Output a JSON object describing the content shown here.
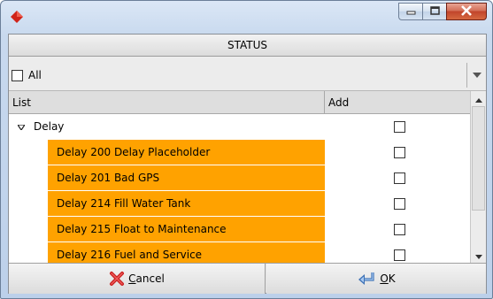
{
  "window": {
    "app_icon": "red-diamond-app-icon",
    "controls": [
      "minimize-icon",
      "maximize-icon",
      "close-icon"
    ]
  },
  "status_header": "STATUS",
  "filter": {
    "all_label": "All",
    "all_checked": false
  },
  "table": {
    "columns": [
      "List",
      "Add"
    ],
    "group": {
      "label": "Delay",
      "expanded": true
    },
    "rows": [
      {
        "label": "Delay 200 Delay Placeholder",
        "checked": false
      },
      {
        "label": "Delay 201 Bad GPS",
        "checked": false
      },
      {
        "label": "Delay 214 Fill Water Tank",
        "checked": false
      },
      {
        "label": "Delay 215 Float to Maintenance",
        "checked": false
      },
      {
        "label": "Delay 216 Fuel and Service",
        "checked": false
      }
    ],
    "highlight_color": "#ffa200"
  },
  "buttons": {
    "cancel": {
      "mnemonic": "C",
      "rest": "ancel",
      "icon": "red-x-icon"
    },
    "ok": {
      "mnemonic": "O",
      "rest": "K",
      "icon": "enter-arrow-icon"
    }
  }
}
